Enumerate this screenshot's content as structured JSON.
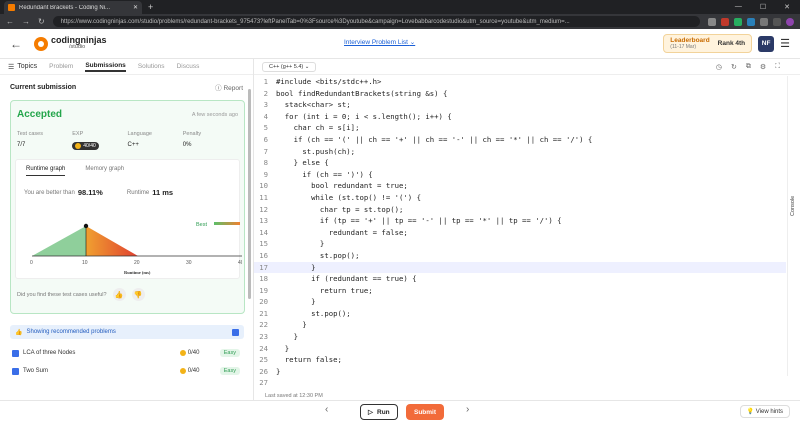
{
  "browser": {
    "tab_title": "Redundant Brackets - Coding Ni...",
    "new_tab": "+",
    "url": "https://www.codingninjas.com/studio/problems/redundant-brackets_975473?leftPanelTab=0%3Fsource%3Dyoutube&campaign=Lovebabbarcodestudio&utm_source=youtube&utm_medium=..."
  },
  "header": {
    "logo_name": "codingninjas",
    "logo_sub": "/studio",
    "problem_list": "Interview Problem List",
    "leaderboard": "Leaderboard",
    "leaderboard_dates": "(11-17 Mar)",
    "rank": "Rank 4th",
    "avatar": "NF"
  },
  "left_tabs": {
    "topics": "Topics",
    "problem": "Problem",
    "submissions": "Submissions",
    "solutions": "Solutions",
    "discuss": "Discuss"
  },
  "submission": {
    "heading": "Current submission",
    "report": "Report",
    "status": "Accepted",
    "time_ago": "A few seconds ago",
    "stats": [
      {
        "label": "Test cases",
        "value": "7/7"
      },
      {
        "label": "EXP",
        "value": "40/40"
      },
      {
        "label": "Language",
        "value": "C++"
      },
      {
        "label": "Penalty",
        "value": "0%"
      }
    ],
    "graph_tabs": [
      "Runtime graph",
      "Memory graph"
    ],
    "better_label": "You are better than",
    "better_value": "98.11%",
    "runtime_label": "Runtime",
    "runtime_value": "11 ms",
    "best": "Best",
    "x_ticks": [
      "0",
      "10",
      "20",
      "30",
      "40"
    ],
    "x_axis": "Runtime (ms)",
    "useful": "Did you find these test cases useful?"
  },
  "recommended": {
    "label": "Showing recommended problems",
    "problems": [
      {
        "name": "LCA of three Nodes",
        "points": "0/40",
        "level": "Easy"
      },
      {
        "name": "Two Sum",
        "points": "0/40",
        "level": "Easy"
      }
    ]
  },
  "editor": {
    "language": "C++ (g++ 5.4)",
    "last_saved": "Last saved at 12:30 PM",
    "console": "Console",
    "lines": [
      "#include <bits/stdc++.h>",
      "bool findRedundantBrackets(string &s) {",
      "  stack<char> st;",
      "  for (int i = 0; i < s.length(); i++) {",
      "    char ch = s[i];",
      "    if (ch == '(' || ch == '+' || ch == '-' || ch == '*' || ch == '/') {",
      "      st.push(ch);",
      "    } else {",
      "      if (ch == ')') {",
      "        bool redundant = true;",
      "        while (st.top() != '(') {",
      "          char tp = st.top();",
      "          if (tp == '+' || tp == '-' || tp == '*' || tp == '/') {",
      "            redundant = false;",
      "          }",
      "          st.pop();",
      "        }",
      "        if (redundant == true) {",
      "          return true;",
      "        }",
      "        st.pop();",
      "      }",
      "    }",
      "  }",
      "  return false;",
      "}",
      ""
    ]
  },
  "footer": {
    "run": "Run",
    "submit": "Submit",
    "hints": "View hints"
  }
}
